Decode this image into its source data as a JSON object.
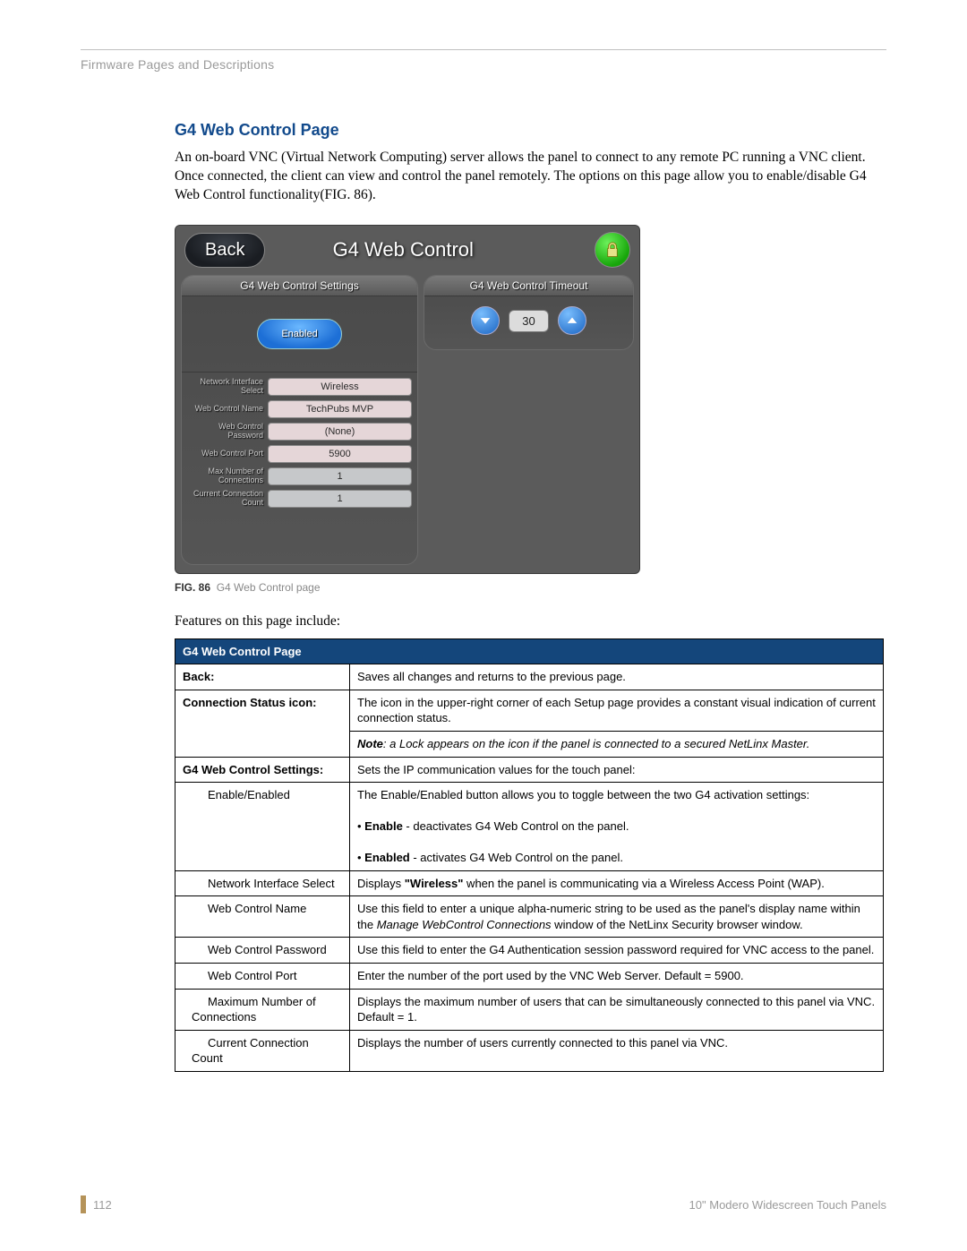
{
  "header": {
    "breadcrumb": "Firmware Pages and Descriptions"
  },
  "section": {
    "title": "G4 Web Control Page",
    "body": "An on-board VNC (Virtual Network Computing) server allows the panel to connect to any remote PC running a VNC client. Once connected, the client can view and control the panel remotely. The options on this page allow you to enable/disable G4 Web Control functionality(FIG. 86)."
  },
  "panel": {
    "back": "Back",
    "title": "G4 Web Control",
    "left_head": "G4 Web Control Settings",
    "right_head": "G4 Web Control Timeout",
    "enabled": "Enabled",
    "timeout_value": "30",
    "rows": [
      {
        "label": "Network Interface Select",
        "value": "Wireless",
        "ro": false
      },
      {
        "label": "Web Control Name",
        "value": "TechPubs MVP",
        "ro": false
      },
      {
        "label": "Web Control Password",
        "value": "(None)",
        "ro": false
      },
      {
        "label": "Web Control Port",
        "value": "5900",
        "ro": false
      },
      {
        "label": "Max Number of Connections",
        "value": "1",
        "ro": true
      },
      {
        "label": "Current Connection Count",
        "value": "1",
        "ro": true
      }
    ]
  },
  "figure": {
    "num": "FIG. 86",
    "caption": "G4 Web Control page"
  },
  "features_line": "Features on this page include:",
  "table": {
    "header": "G4 Web Control Page",
    "rows": [
      {
        "label": "Back:",
        "desc": "Saves all changes and returns to the previous page."
      },
      {
        "label": "Connection Status icon:",
        "desc": "The icon in the upper-right corner of each Setup page provides a constant visual indication of current connection status."
      },
      {
        "note": "Note: a Lock appears on the icon if the panel is connected to a secured NetLinx Master."
      },
      {
        "label": "G4 Web Control Settings:",
        "desc": "Sets the IP communication values for the touch panel:"
      },
      {
        "sub": "Enable/Enabled",
        "desc_html": "The Enable/Enabled button allows you to toggle between the two G4 activation settings:<br><br>• <b>Enable</b> - deactivates G4 Web Control on the panel.<br><br>• <b>Enabled</b> - activates G4 Web Control on the panel."
      },
      {
        "sub": "Network Interface Select",
        "desc_html": "Displays <b>\"Wireless\"</b> when the panel is communicating via a Wireless Access Point (WAP)."
      },
      {
        "sub": "Web Control Name",
        "desc_html": "Use this field to enter a unique alpha-numeric string to be used as the panel's display name within the <i>Manage WebControl Connections</i> window of the NetLinx Security browser window."
      },
      {
        "sub": "Web Control Password",
        "desc": "Use this field to enter the G4 Authentication session password required for VNC access to the panel."
      },
      {
        "sub": "Web Control Port",
        "desc": "Enter the number of the port used by the VNC Web Server. Default = 5900."
      },
      {
        "sub": "Maximum Number of Connections",
        "desc": "Displays the maximum number of users that can be simultaneously connected to this panel via VNC. Default = 1."
      },
      {
        "sub": "Current Connection Count",
        "desc": "Displays the number of users currently connected to this panel via VNC."
      }
    ]
  },
  "footer": {
    "page": "112",
    "doc": "10\" Modero Widescreen Touch Panels"
  }
}
